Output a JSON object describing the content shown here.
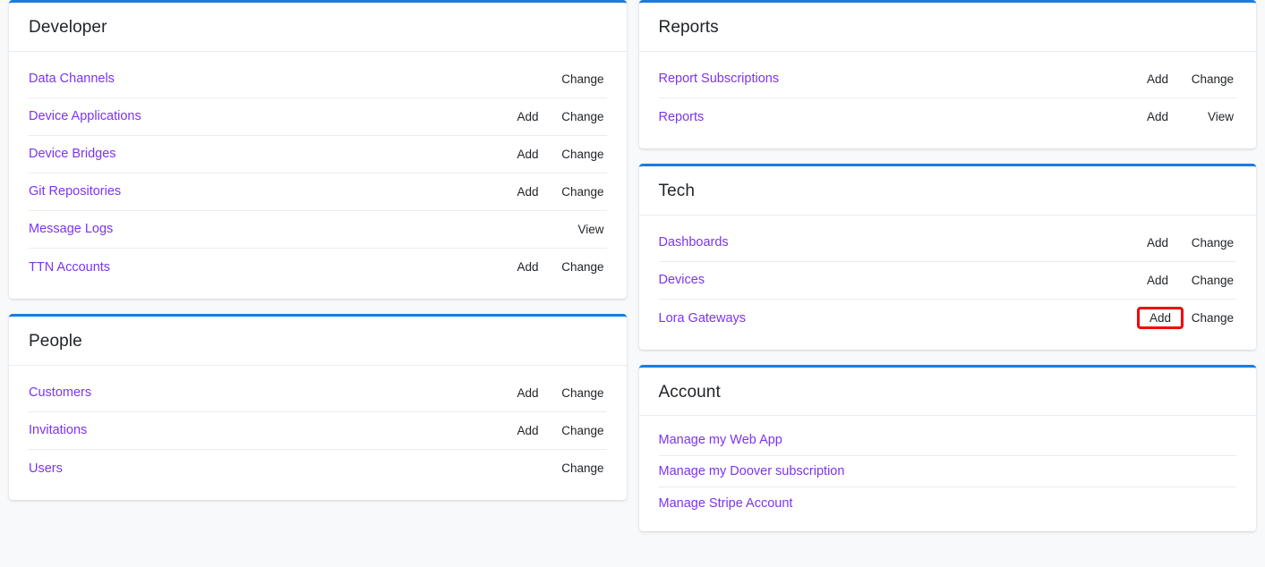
{
  "theme": {
    "page_background": "#f8f9fa",
    "card_background": "#ffffff",
    "card_top_border": "#1a7ce0",
    "link_color": "#7c34f0",
    "action_color": "#212529",
    "divider_color": "#e9ecef",
    "highlight_color": "#f50000"
  },
  "columns": {
    "left": [
      {
        "title": "Developer",
        "rows": [
          {
            "name": "Data Channels",
            "add": null,
            "change": "Change"
          },
          {
            "name": "Device Applications",
            "add": "Add",
            "change": "Change"
          },
          {
            "name": "Device Bridges",
            "add": "Add",
            "change": "Change"
          },
          {
            "name": "Git Repositories",
            "add": "Add",
            "change": "Change"
          },
          {
            "name": "Message Logs",
            "add": null,
            "change": "View"
          },
          {
            "name": "TTN Accounts",
            "add": "Add",
            "change": "Change"
          }
        ]
      },
      {
        "title": "People",
        "rows": [
          {
            "name": "Customers",
            "add": "Add",
            "change": "Change"
          },
          {
            "name": "Invitations",
            "add": "Add",
            "change": "Change"
          },
          {
            "name": "Users",
            "add": null,
            "change": "Change"
          }
        ]
      }
    ],
    "right": [
      {
        "title": "Reports",
        "rows": [
          {
            "name": "Report Subscriptions",
            "add": "Add",
            "change": "Change"
          },
          {
            "name": "Reports",
            "add": "Add",
            "change": "View"
          }
        ]
      },
      {
        "title": "Tech",
        "rows": [
          {
            "name": "Dashboards",
            "add": "Add",
            "change": "Change"
          },
          {
            "name": "Devices",
            "add": "Add",
            "change": "Change"
          },
          {
            "name": "Lora Gateways",
            "add": "Add",
            "change": "Change",
            "highlight": "add"
          }
        ]
      },
      {
        "title": "Account",
        "links": [
          "Manage my Web App",
          "Manage my Doover subscription",
          "Manage Stripe Account"
        ]
      }
    ]
  }
}
